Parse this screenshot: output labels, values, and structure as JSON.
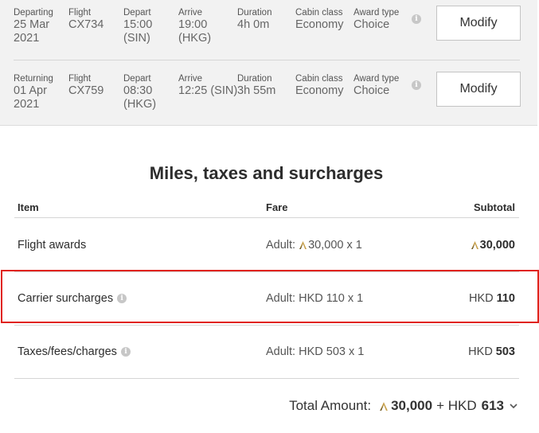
{
  "flights": [
    {
      "direction_label": "Departing",
      "date": "25 Mar\n2021",
      "flight_label": "Flight",
      "flight_no": "CX734",
      "depart_label": "Depart",
      "depart": "15:00\n(SIN)",
      "arrive_label": "Arrive",
      "arrive": "19:00\n(HKG)",
      "duration_label": "Duration",
      "duration": "4h 0m",
      "cabin_label": "Cabin class",
      "cabin": "Economy",
      "award_label": "Award type",
      "award": "Choice",
      "modify_label": "Modify"
    },
    {
      "direction_label": "Returning",
      "date": "01 Apr\n2021",
      "flight_label": "Flight",
      "flight_no": "CX759",
      "depart_label": "Depart",
      "depart": "08:30\n(HKG)",
      "arrive_label": "Arrive",
      "arrive": "12:25 (SIN)",
      "duration_label": "Duration",
      "duration": "3h 55m",
      "cabin_label": "Cabin class",
      "cabin": "Economy",
      "award_label": "Award type",
      "award": "Choice",
      "modify_label": "Modify"
    }
  ],
  "charges": {
    "title": "Miles, taxes and surcharges",
    "headers": {
      "item": "Item",
      "fare": "Fare",
      "subtotal": "Subtotal"
    },
    "rows": [
      {
        "item": "Flight awards",
        "fare_prefix": "Adult: ",
        "fare_amount": "30,000 x 1",
        "sub_currency": "",
        "sub_amount": "30,000",
        "miles": true,
        "info": false
      },
      {
        "item": "Carrier surcharges",
        "fare_prefix": "Adult: ",
        "fare_amount": "HKD 110 x 1",
        "sub_currency": "HKD",
        "sub_amount": "110",
        "miles": false,
        "info": true
      },
      {
        "item": "Taxes/fees/charges",
        "fare_prefix": "Adult: ",
        "fare_amount": "HKD 503 x 1",
        "sub_currency": "HKD",
        "sub_amount": "503",
        "miles": false,
        "info": true
      }
    ],
    "highlighted_row": "Carrier surcharges"
  },
  "total": {
    "label": "Total Amount:",
    "miles": "30,000",
    "plus": "+ HKD",
    "cash": "613"
  },
  "colors": {
    "panel_bg": "#f2f2f2",
    "highlight": "#e0231b",
    "asia_miles_gold": "#c8a04a"
  },
  "icons": {
    "info": "info-icon",
    "asia_miles": "asia-miles-icon",
    "expand": "chevron-down-icon"
  }
}
